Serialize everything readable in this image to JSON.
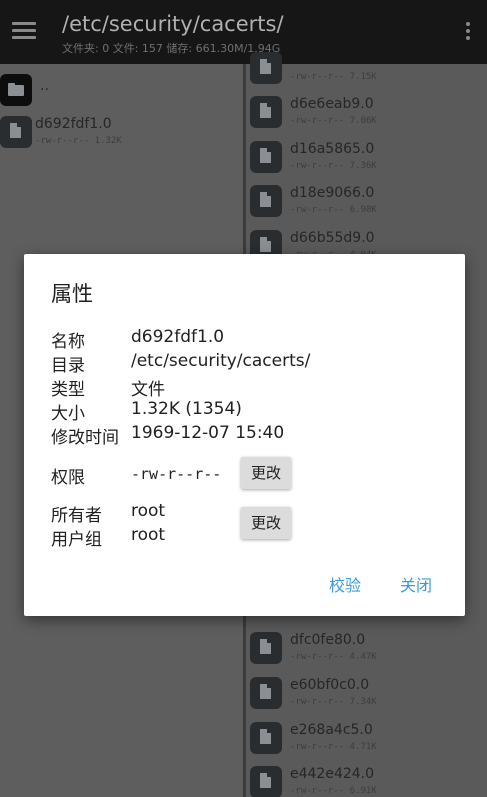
{
  "header": {
    "title": "/etc/security/cacerts/",
    "subtitle": "文件夹: 0  文件: 157  储存: 661.30M/1.94G"
  },
  "left_list": [
    {
      "name": "..",
      "meta": "",
      "type": "folder"
    },
    {
      "name": "d692fdf1.0",
      "meta": "-rw-r--r--   1.32K",
      "type": "file"
    }
  ],
  "right_list_top": [
    {
      "name": "",
      "meta": "-rw-r--r--   7.15K"
    },
    {
      "name": "d6e6eab9.0",
      "meta": "-rw-r--r--   7.06K"
    },
    {
      "name": "d16a5865.0",
      "meta": "-rw-r--r--   7.36K"
    },
    {
      "name": "d18e9066.0",
      "meta": "-rw-r--r--   6.90K"
    },
    {
      "name": "d66b55d9.0",
      "meta": "-rw-r--r--   4.04K"
    }
  ],
  "right_list_bottom": [
    {
      "name": "dfc0fe80.0",
      "meta": "-rw-r--r--   4.47K"
    },
    {
      "name": "e60bf0c0.0",
      "meta": "-rw-r--r--   7.34K"
    },
    {
      "name": "e268a4c5.0",
      "meta": "-rw-r--r--   4.71K"
    },
    {
      "name": "e442e424.0",
      "meta": "-rw-r--r--   6.91K"
    }
  ],
  "dialog": {
    "title": "属性",
    "name_label": "名称",
    "name_value": "d692fdf1.0",
    "dir_label": "目录",
    "dir_value": "/etc/security/cacerts/",
    "type_label": "类型",
    "type_value": "文件",
    "size_label": "大小",
    "size_value": "1.32K (1354)",
    "mtime_label": "修改时间",
    "mtime_value": "1969-12-07 15:40",
    "perm_label": "权限",
    "perm_value": "-rw-r--r--",
    "change_label": "更改",
    "owner_label": "所有者",
    "owner_value": "root",
    "group_label": "用户组",
    "group_value": "root",
    "checksum_label": "校验",
    "close_label": "关闭"
  }
}
